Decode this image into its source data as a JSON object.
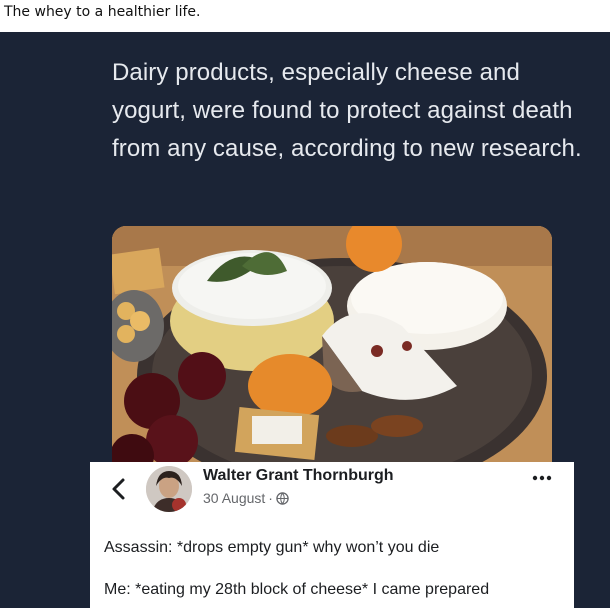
{
  "post": {
    "caption": "The whey to a healthier life."
  },
  "tweet": {
    "text": "Dairy products, especially cheese and yogurt, were found to protect against death from any cause, according to new research."
  },
  "facebook_post": {
    "author": "Walter Grant Thornburgh",
    "date": "30 August",
    "separator": "·",
    "lines": [
      "Assassin: *drops empty gun* why won’t you die",
      "Me: *eating my 28th block of cheese* I came prepared"
    ]
  },
  "colors": {
    "tweet_background": "#1b2436",
    "tweet_text": "#e6e9ee",
    "secondary_text": "#65676b"
  }
}
